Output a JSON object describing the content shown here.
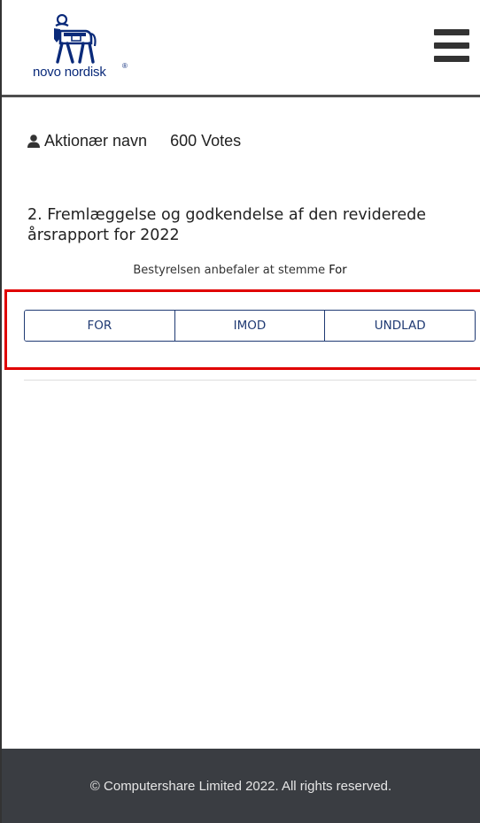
{
  "header": {
    "brand_name": "novo nordisk",
    "brand_reg": "®",
    "logo_icon": "apis-bull-logo",
    "menu_icon": "hamburger-menu-icon"
  },
  "user": {
    "icon": "user-icon",
    "name": "Aktionær navn",
    "votes": "600 Votes"
  },
  "question": {
    "title": "2. Fremlæggelse og godkendelse af den reviderede årsrapport for 2022",
    "recommendation_prefix": "Bestyrelsen anbefaler at stemme",
    "recommendation_value": "For"
  },
  "vote_options": [
    {
      "label": "FOR"
    },
    {
      "label": "IMOD"
    },
    {
      "label": "UNDLAD"
    }
  ],
  "footer": {
    "text": "© Computershare Limited 2022. All rights reserved."
  },
  "colors": {
    "brand_blue": "#0a2a7a",
    "button_border": "#1f3a73",
    "highlight": "#e00000",
    "footer_bg": "#3a3d42"
  }
}
